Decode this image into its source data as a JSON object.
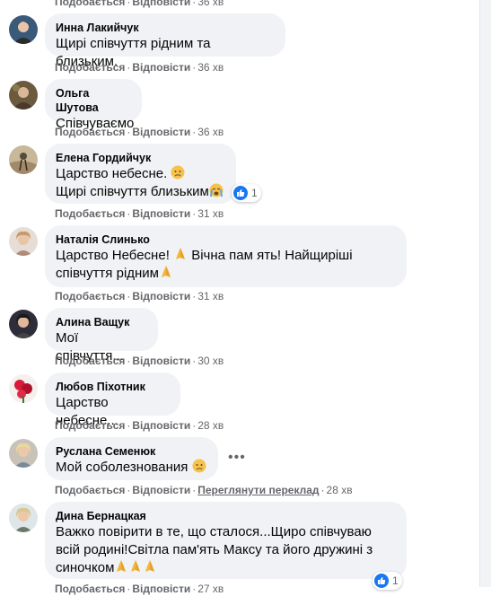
{
  "action_labels": {
    "like": "Подобається",
    "reply": "Відповісти",
    "translate": "Переглянути переклад"
  },
  "top_actions": {
    "time": "36 хв"
  },
  "comments": [
    {
      "name": "Инна Лакийчук",
      "lines": [
        "Щирі співчуття рідним та близьким."
      ],
      "time": "36 хв"
    },
    {
      "name": "Ольга Шутова",
      "lines": [
        "Співчуваємо"
      ],
      "time": "36 хв"
    },
    {
      "name": "Елена Гордийчук",
      "lines": [
        "Царство небесне.",
        "Щирі співчуття близьким"
      ],
      "time": "31 хв",
      "reactions": "1"
    },
    {
      "name": "Наталія Слинько",
      "lines": [
        "Царство Небесне!",
        "Вічна пам ять! Найщиріші",
        "співчуття рідним"
      ],
      "time": "31 хв"
    },
    {
      "name": "Алина Ващук",
      "lines": [
        "Мої співчуття..."
      ],
      "time": "30 хв"
    },
    {
      "name": "Любов Піхотник",
      "lines": [
        "Царство небесне..."
      ],
      "time": "28 хв"
    },
    {
      "name": "Руслана Семенюк",
      "lines": [
        "Мой соболезнования"
      ],
      "time": "28 хв",
      "more": "•••"
    },
    {
      "name": "Дина Бернацкая",
      "lines": [
        "Важко повірити в те, що сталося...Щиро співчуваю",
        "всій родині!Світла пам'ять Максу та його дружині з",
        "синочком"
      ],
      "time": "27 хв",
      "reactions": "1"
    }
  ],
  "colors": {
    "bubble": "#f0f2f5",
    "meta": "#65676b",
    "text": "#050505",
    "like": "#1877f2"
  },
  "icons": [
    "crying-face-icon",
    "loudly-crying-face-icon",
    "folded-hands-icon",
    "like-reaction-icon",
    "more-options-icon"
  ]
}
